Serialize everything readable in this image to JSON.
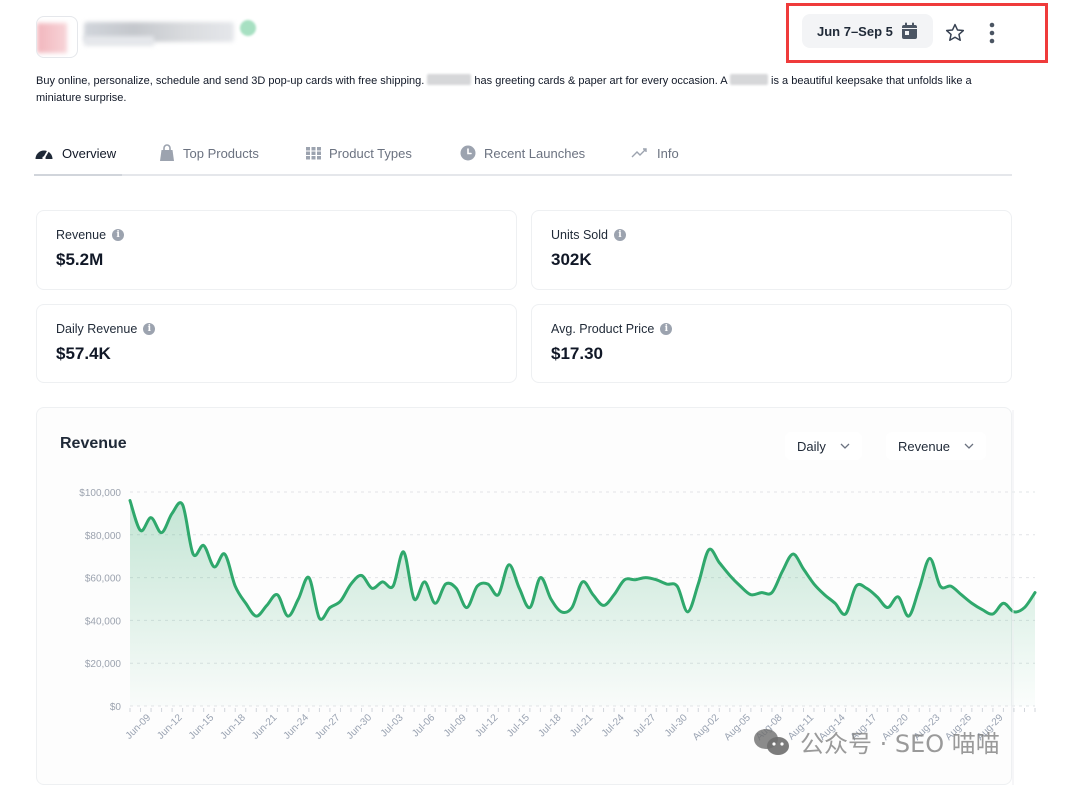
{
  "header": {
    "date_range": "Jun 7–Sep 5",
    "calendar_icon": "calendar-icon",
    "favorite_icon": "star-outline-icon",
    "more_icon": "vertical-dots-icon"
  },
  "description": {
    "part1": "Buy online, personalize, schedule and send 3D pop-up cards with free shipping. ",
    "part2": " has greeting cards & paper art for every occasion. A ",
    "part3": " is a beautiful keepsake that unfolds like a miniature surprise."
  },
  "tabs": [
    {
      "label": "Overview",
      "icon": "dashboard-gauge-icon",
      "active": true
    },
    {
      "label": "Top Products",
      "icon": "shopping-bag-icon",
      "active": false
    },
    {
      "label": "Product Types",
      "icon": "grid-icon",
      "active": false
    },
    {
      "label": "Recent Launches",
      "icon": "clock-icon",
      "active": false
    },
    {
      "label": "Info",
      "icon": "trend-line-icon",
      "active": false
    }
  ],
  "metrics": [
    {
      "label": "Revenue",
      "value": "$5.2M"
    },
    {
      "label": "Units Sold",
      "value": "302K"
    },
    {
      "label": "Daily Revenue",
      "value": "$57.4K"
    },
    {
      "label": "Avg. Product Price",
      "value": "$17.30"
    }
  ],
  "chart_panel": {
    "title": "Revenue",
    "interval_select": "Daily",
    "metric_select": "Revenue"
  },
  "watermark": "公众号 · SEO 喵喵",
  "chart_data": {
    "type": "area",
    "title": "Revenue",
    "xlabel": "",
    "ylabel": "",
    "ylim": [
      0,
      100000
    ],
    "yticks": [
      0,
      20000,
      40000,
      60000,
      80000,
      100000
    ],
    "ytick_labels": [
      "$0",
      "$20,000",
      "$40,000",
      "$60,000",
      "$80,000",
      "$100,000"
    ],
    "grid": true,
    "line_color": "#2fa86c",
    "xtick_labels": [
      "Jun-09",
      "Jun-12",
      "Jun-15",
      "Jun-18",
      "Jun-21",
      "Jun-24",
      "Jun-27",
      "Jun-30",
      "Jul-03",
      "Jul-06",
      "Jul-09",
      "Jul-12",
      "Jul-15",
      "Jul-18",
      "Jul-21",
      "Jul-24",
      "Jul-27",
      "Jul-30",
      "Aug-02",
      "Aug-05",
      "Aug-08",
      "Aug-11",
      "Aug-14",
      "Aug-17",
      "Aug-20",
      "Aug-23",
      "Aug-26",
      "Aug-29"
    ],
    "x_start": "Jun-07",
    "series": [
      {
        "name": "Revenue",
        "values": [
          96000,
          82000,
          88000,
          81000,
          90000,
          94000,
          71000,
          75000,
          65000,
          71000,
          56000,
          48000,
          42000,
          47000,
          52000,
          42000,
          50000,
          60000,
          41000,
          46000,
          49000,
          57000,
          61000,
          55000,
          58000,
          56000,
          72000,
          50000,
          58000,
          48000,
          57000,
          55000,
          46000,
          56000,
          57000,
          52000,
          66000,
          55000,
          46000,
          60000,
          50000,
          44000,
          46000,
          58000,
          52000,
          47000,
          52000,
          59000,
          59000,
          60000,
          59000,
          57000,
          56000,
          44000,
          57000,
          73000,
          67000,
          61000,
          56000,
          52000,
          53000,
          53000,
          63000,
          71000,
          64000,
          57000,
          52000,
          48000,
          43000,
          56000,
          55000,
          51000,
          46000,
          51000,
          42000,
          55000,
          69000,
          56000,
          56000,
          52000,
          48000,
          45000,
          43000,
          48000,
          44000,
          46000,
          53000
        ]
      }
    ]
  }
}
